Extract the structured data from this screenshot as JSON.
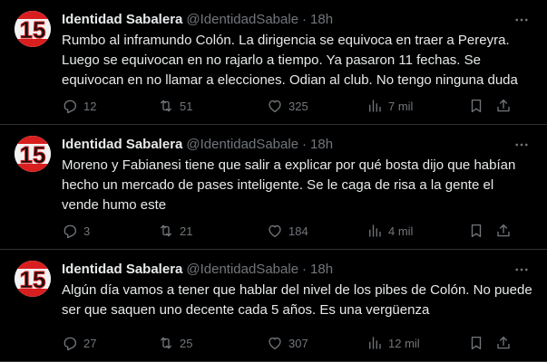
{
  "tweets": [
    {
      "name": "Identidad Sabalera",
      "handle": "@IdentidadSabale",
      "separator": "·",
      "time": "18h",
      "text": "Rumbo al inframundo Colón. La dirigencia se equivoca en traer a Pereyra. Luego se equivocan en no rajarlo a tiempo. Ya pasaron 11 fechas. Se equivocan en no llamar a elecciones. Odian al club. No tengo ninguna duda",
      "replies": "12",
      "retweets": "51",
      "likes": "325",
      "views": "7 mil"
    },
    {
      "name": "Identidad Sabalera",
      "handle": "@IdentidadSabale",
      "separator": "·",
      "time": "18h",
      "text": "Moreno y Fabianesi tiene que salir a explicar por qué bosta dijo que habían hecho un mercado de pases inteligente. Se le caga de risa a la gente el vende humo este",
      "replies": "3",
      "retweets": "21",
      "likes": "184",
      "views": "4 mil"
    },
    {
      "name": "Identidad Sabalera",
      "handle": "@IdentidadSabale",
      "separator": "·",
      "time": "18h",
      "text": "Algún día vamos a tener que hablar del nivel de los pibes de Colón. No puede ser que saquen uno decente cada 5 años. Es una vergüenza",
      "replies": "27",
      "retweets": "25",
      "likes": "307",
      "views": "12 mil"
    }
  ],
  "avatar_text": "15",
  "icons": {
    "reply": "reply-icon",
    "retweet": "retweet-icon",
    "like": "heart-icon",
    "views": "views-icon",
    "bookmark": "bookmark-icon",
    "share": "share-icon",
    "more": "more-icon"
  },
  "colors": {
    "background": "#000000",
    "text": "#e7e9ea",
    "secondary": "#71767b",
    "divider": "#2f3336",
    "avatar_red": "#d81e1e"
  }
}
